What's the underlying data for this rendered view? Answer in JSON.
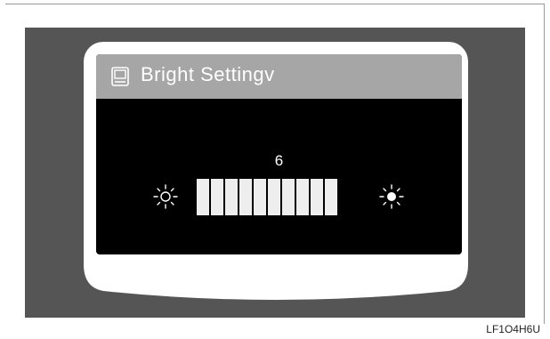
{
  "dialog": {
    "title": "Bright Settingv",
    "icon": "monitor-icon"
  },
  "brightness": {
    "value": "6",
    "level": 6,
    "max": 10,
    "low_icon": "sun-outline-icon",
    "high_icon": "sun-filled-icon"
  },
  "figure_code": "LF1O4H6U",
  "colors": {
    "backdrop": "#555555",
    "title_bar": "#a6a6a6",
    "screen": "#000000",
    "segment_on": "#eeeeee"
  }
}
